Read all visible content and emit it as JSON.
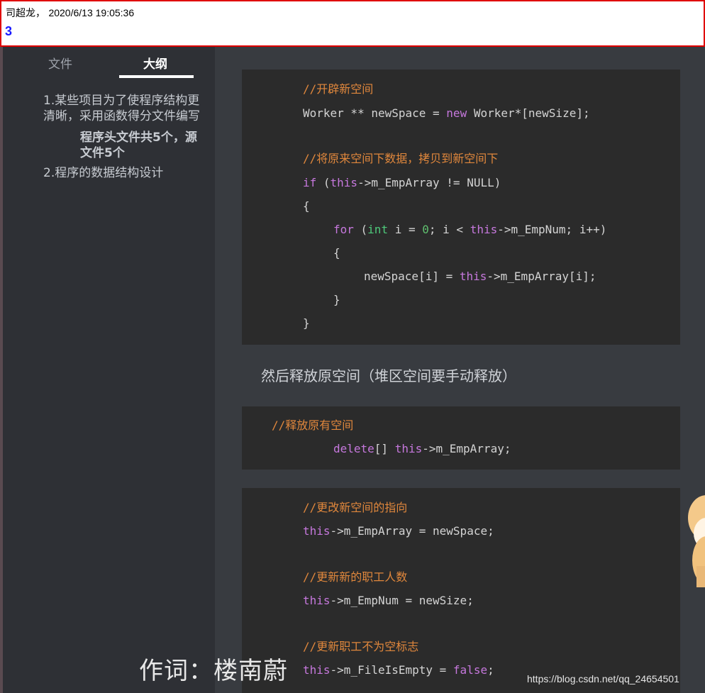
{
  "header": {
    "author": "司超龙",
    "separator": "，",
    "datetime": "2020/6/13 19:05:36",
    "count": "3"
  },
  "sidebar": {
    "tabs": [
      {
        "label": "文件"
      },
      {
        "label": "大纲"
      }
    ],
    "outline": {
      "item1": "1.某些项目为了使程序结构更清晰，采用函数得分文件编写",
      "item1_sub": "程序头文件共5个，源文件5个",
      "item2": "2.程序的数据结构设计"
    }
  },
  "main": {
    "block1": {
      "l1": "//开辟新空间",
      "l2_a": "Worker ** newSpace = ",
      "l2_kw": "new",
      "l2_b": " Worker*[newSize];",
      "l3": "//将原来空间下数据，拷贝到新空间下",
      "l4_kw1": "if",
      "l4_a": " (",
      "l4_kw2": "this",
      "l4_b": "->m_EmpArray != NULL)",
      "l5": "{",
      "l6_kw1": "for",
      "l6_a": " (",
      "l6_type": "int",
      "l6_b": " i = ",
      "l6_num": "0",
      "l6_c": "; i < ",
      "l6_kw2": "this",
      "l6_d": "->m_EmpNum; i++)",
      "l7": "{",
      "l8_a": "newSpace[i] = ",
      "l8_kw": "this",
      "l8_b": "->m_EmpArray[i];",
      "l9": "}",
      "l10": "}"
    },
    "paragraph": "然后释放原空间（堆区空间要手动释放）",
    "block2": {
      "l1": "//释放原有空间",
      "l2_kw1": "delete",
      "l2_a": "[] ",
      "l2_kw2": "this",
      "l2_b": "->m_EmpArray;"
    },
    "block3": {
      "l1": "//更改新空间的指向",
      "l2_kw": "this",
      "l2_b": "->m_EmpArray = newSpace;",
      "l3": "//更新新的职工人数",
      "l4_kw": "this",
      "l4_b": "->m_EmpNum = newSize;",
      "l5": "//更新职工不为空标志",
      "l6_kw": "this",
      "l6_b": "->m_FileIsEmpty = ",
      "l6_kw2": "false",
      "l6_c": ";"
    }
  },
  "overlay": {
    "lyrics": "作词：楼南蔚",
    "url": "https://blog.csdn.net/qq_24654501"
  },
  "colors": {
    "comment": "#e0873c",
    "keyword": "#c678dd",
    "number": "#5fbf6e",
    "type": "#4ec97a",
    "border": "#e00000",
    "count": "#1a1aff"
  }
}
